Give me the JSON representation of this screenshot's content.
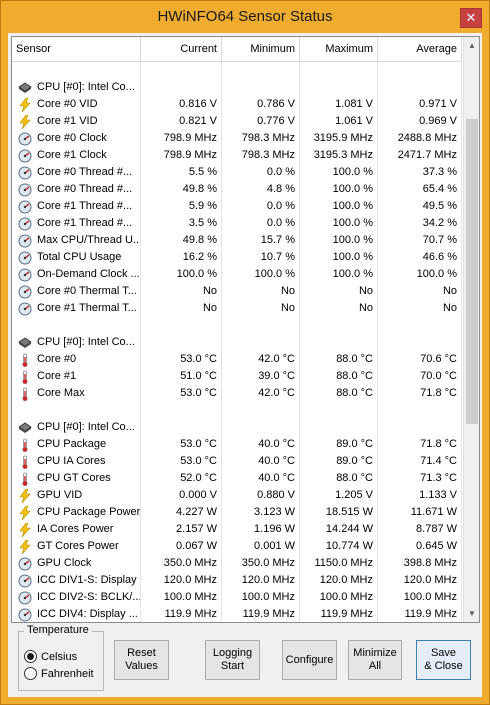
{
  "window": {
    "title": "HWiNFO64 Sensor Status",
    "close_label": "✕"
  },
  "columns": [
    "Sensor",
    "Current",
    "Minimum",
    "Maximum",
    "Average"
  ],
  "rows": [
    {
      "type": "blank"
    },
    {
      "type": "group",
      "icon": "cpu-chip-icon",
      "name": "CPU [#0]: Intel Co..."
    },
    {
      "type": "data",
      "icon": "voltage-bolt-icon",
      "name": "Core #0 VID",
      "cur": "0.816 V",
      "min": "0.786 V",
      "max": "1.081 V",
      "avg": "0.971 V"
    },
    {
      "type": "data",
      "icon": "voltage-bolt-icon",
      "name": "Core #1 VID",
      "cur": "0.821 V",
      "min": "0.776 V",
      "max": "1.061 V",
      "avg": "0.969 V"
    },
    {
      "type": "data",
      "icon": "gauge-icon",
      "name": "Core #0 Clock",
      "cur": "798.9 MHz",
      "min": "798.3 MHz",
      "max": "3195.9 MHz",
      "avg": "2488.8 MHz"
    },
    {
      "type": "data",
      "icon": "gauge-icon",
      "name": "Core #1 Clock",
      "cur": "798.9 MHz",
      "min": "798.3 MHz",
      "max": "3195.3 MHz",
      "avg": "2471.7 MHz"
    },
    {
      "type": "data",
      "icon": "gauge-icon",
      "name": "Core #0 Thread #...",
      "cur": "5.5 %",
      "min": "0.0 %",
      "max": "100.0 %",
      "avg": "37.3 %"
    },
    {
      "type": "data",
      "icon": "gauge-icon",
      "name": "Core #0 Thread #...",
      "cur": "49.8 %",
      "min": "4.8 %",
      "max": "100.0 %",
      "avg": "65.4 %"
    },
    {
      "type": "data",
      "icon": "gauge-icon",
      "name": "Core #1 Thread #...",
      "cur": "5.9 %",
      "min": "0.0 %",
      "max": "100.0 %",
      "avg": "49.5 %"
    },
    {
      "type": "data",
      "icon": "gauge-icon",
      "name": "Core #1 Thread #...",
      "cur": "3.5 %",
      "min": "0.0 %",
      "max": "100.0 %",
      "avg": "34.2 %"
    },
    {
      "type": "data",
      "icon": "gauge-icon",
      "name": "Max CPU/Thread U...",
      "cur": "49.8 %",
      "min": "15.7 %",
      "max": "100.0 %",
      "avg": "70.7 %"
    },
    {
      "type": "data",
      "icon": "gauge-icon",
      "name": "Total CPU Usage",
      "cur": "16.2 %",
      "min": "10.7 %",
      "max": "100.0 %",
      "avg": "46.6 %"
    },
    {
      "type": "data",
      "icon": "gauge-icon",
      "name": "On-Demand Clock ...",
      "cur": "100.0 %",
      "min": "100.0 %",
      "max": "100.0 %",
      "avg": "100.0 %"
    },
    {
      "type": "data",
      "icon": "gauge-icon",
      "name": "Core #0 Thermal T...",
      "cur": "No",
      "min": "No",
      "max": "No",
      "avg": "No"
    },
    {
      "type": "data",
      "icon": "gauge-icon",
      "name": "Core #1 Thermal T...",
      "cur": "No",
      "min": "No",
      "max": "No",
      "avg": "No"
    },
    {
      "type": "blank"
    },
    {
      "type": "group",
      "icon": "cpu-chip-icon",
      "name": "CPU [#0]: Intel Co..."
    },
    {
      "type": "data",
      "icon": "thermometer-icon",
      "name": "Core #0",
      "cur": "53.0 °C",
      "min": "42.0 °C",
      "max": "88.0 °C",
      "avg": "70.6 °C"
    },
    {
      "type": "data",
      "icon": "thermometer-icon",
      "name": "Core #1",
      "cur": "51.0 °C",
      "min": "39.0 °C",
      "max": "88.0 °C",
      "avg": "70.0 °C"
    },
    {
      "type": "data",
      "icon": "thermometer-icon",
      "name": "Core Max",
      "cur": "53.0 °C",
      "min": "42.0 °C",
      "max": "88.0 °C",
      "avg": "71.8 °C"
    },
    {
      "type": "blank"
    },
    {
      "type": "group",
      "icon": "cpu-chip-icon",
      "name": "CPU [#0]: Intel Co..."
    },
    {
      "type": "data",
      "icon": "thermometer-icon",
      "name": "CPU Package",
      "cur": "53.0 °C",
      "min": "40.0 °C",
      "max": "89.0 °C",
      "avg": "71.8 °C"
    },
    {
      "type": "data",
      "icon": "thermometer-icon",
      "name": "CPU IA Cores",
      "cur": "53.0 °C",
      "min": "40.0 °C",
      "max": "89.0 °C",
      "avg": "71.4 °C"
    },
    {
      "type": "data",
      "icon": "thermometer-icon",
      "name": "CPU GT Cores",
      "cur": "52.0 °C",
      "min": "40.0 °C",
      "max": "88.0 °C",
      "avg": "71.3 °C"
    },
    {
      "type": "data",
      "icon": "voltage-bolt-icon",
      "name": "GPU VID",
      "cur": "0.000 V",
      "min": "0.880 V",
      "max": "1.205 V",
      "avg": "1.133 V"
    },
    {
      "type": "data",
      "icon": "voltage-bolt-icon",
      "name": "CPU Package Power",
      "cur": "4.227 W",
      "min": "3.123 W",
      "max": "18.515 W",
      "avg": "11.671 W"
    },
    {
      "type": "data",
      "icon": "voltage-bolt-icon",
      "name": "IA Cores Power",
      "cur": "2.157 W",
      "min": "1.196 W",
      "max": "14.244 W",
      "avg": "8.787 W"
    },
    {
      "type": "data",
      "icon": "voltage-bolt-icon",
      "name": "GT Cores Power",
      "cur": "0.067 W",
      "min": "0.001 W",
      "max": "10.774 W",
      "avg": "0.645 W"
    },
    {
      "type": "data",
      "icon": "gauge-icon",
      "name": "GPU Clock",
      "cur": "350.0 MHz",
      "min": "350.0 MHz",
      "max": "1150.0 MHz",
      "avg": "398.8 MHz"
    },
    {
      "type": "data",
      "icon": "gauge-icon",
      "name": "ICC DIV1-S: Display",
      "cur": "120.0 MHz",
      "min": "120.0 MHz",
      "max": "120.0 MHz",
      "avg": "120.0 MHz"
    },
    {
      "type": "data",
      "icon": "gauge-icon",
      "name": "ICC DIV2-S: BCLK/...",
      "cur": "100.0 MHz",
      "min": "100.0 MHz",
      "max": "100.0 MHz",
      "avg": "100.0 MHz"
    },
    {
      "type": "data",
      "icon": "gauge-icon",
      "name": "ICC DIV4: Display ...",
      "cur": "119.9 MHz",
      "min": "119.9 MHz",
      "max": "119.9 MHz",
      "avg": "119.9 MHz"
    }
  ],
  "temperature": {
    "legend": "Temperature",
    "options": [
      {
        "label": "Celsius",
        "selected": true
      },
      {
        "label": "Fahrenheit",
        "selected": false
      }
    ]
  },
  "buttons": {
    "reset": "Reset\nValues",
    "logging": "Logging\nStart",
    "configure": "Configure",
    "minimize": "Minimize\nAll",
    "save_close": "Save\n& Close"
  },
  "colors": {
    "title_bar": "#f0ac2e",
    "close_button": "#c74141"
  }
}
